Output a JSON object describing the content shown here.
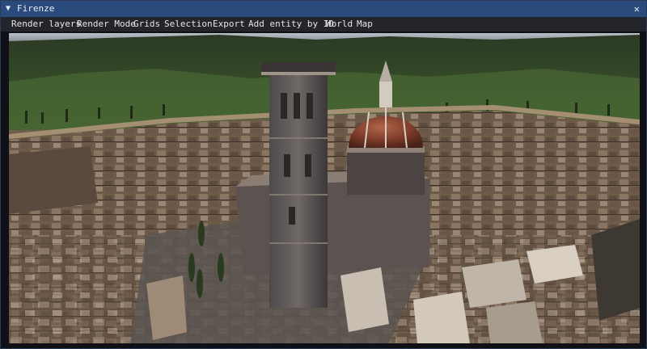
{
  "window": {
    "title": "Firenze",
    "collapse_glyph": "▼",
    "close_glyph": "✕"
  },
  "menu": [
    {
      "label": "Render layers"
    },
    {
      "label": "Render Mode"
    },
    {
      "label": "Grids"
    },
    {
      "label": "Selection"
    },
    {
      "label": "Export"
    },
    {
      "label": "Add entity by ID"
    },
    {
      "label": "World"
    },
    {
      "label": "Map"
    }
  ],
  "icons": {
    "collapse": "triangle-down-icon",
    "close": "close-icon"
  },
  "colors": {
    "titlebar": "#294a7a",
    "menubar": "#23252b",
    "window_bg": "#0f1117"
  }
}
